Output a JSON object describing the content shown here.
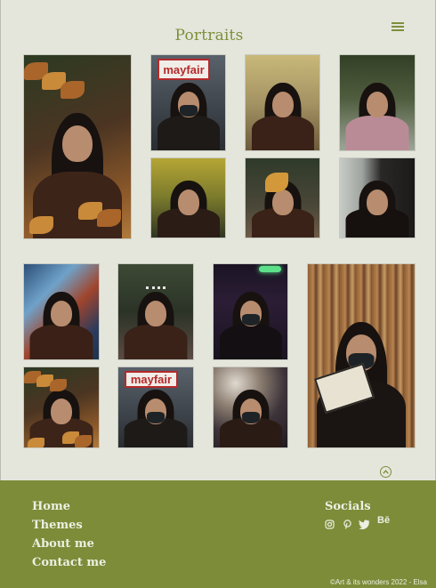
{
  "page": {
    "title": "Portraits",
    "menu_icon": "hamburger-menu-icon"
  },
  "gallery": {
    "group1": [
      {
        "name": "portrait-leaves-crown",
        "scene": "leaves"
      },
      {
        "name": "portrait-mayfair-sign",
        "scene": "mayfair"
      },
      {
        "name": "portrait-autumn-field",
        "scene": "field"
      },
      {
        "name": "portrait-pink-coat",
        "scene": "pinkcoat"
      },
      {
        "name": "portrait-yellow-trees",
        "scene": "yellowtrees"
      },
      {
        "name": "portrait-leaf-over-eye",
        "scene": "leafeye"
      },
      {
        "name": "portrait-doorway",
        "scene": "doorway"
      }
    ],
    "group2": [
      {
        "name": "portrait-graffiti-wall",
        "scene": "graffiti"
      },
      {
        "name": "portrait-tiara",
        "scene": "tiara"
      },
      {
        "name": "portrait-neon-night",
        "scene": "neon"
      },
      {
        "name": "portrait-bookshelf-reading",
        "scene": "bookshelf"
      },
      {
        "name": "portrait-leaves-closeup",
        "scene": "leaves"
      },
      {
        "name": "portrait-mayfair-masked",
        "scene": "mayfair"
      },
      {
        "name": "portrait-masked-lights",
        "scene": "lights"
      }
    ]
  },
  "scroll_top_icon": "chevron-up-circle-icon",
  "footer": {
    "nav": [
      "Home",
      "Themes",
      "About me",
      "Contact me"
    ],
    "socials_title": "Socials",
    "socials": [
      "instagram-icon",
      "pinterest-icon",
      "twitter-icon",
      "behance-icon"
    ],
    "behance_label": "Bē",
    "mayfair_sign": "mayfair",
    "copyright": "©Art & its wonders 2022 - Elsa"
  },
  "colors": {
    "accent": "#7d8f3a",
    "footer_bg": "#7c8c39",
    "background": "#e4e6dc"
  }
}
